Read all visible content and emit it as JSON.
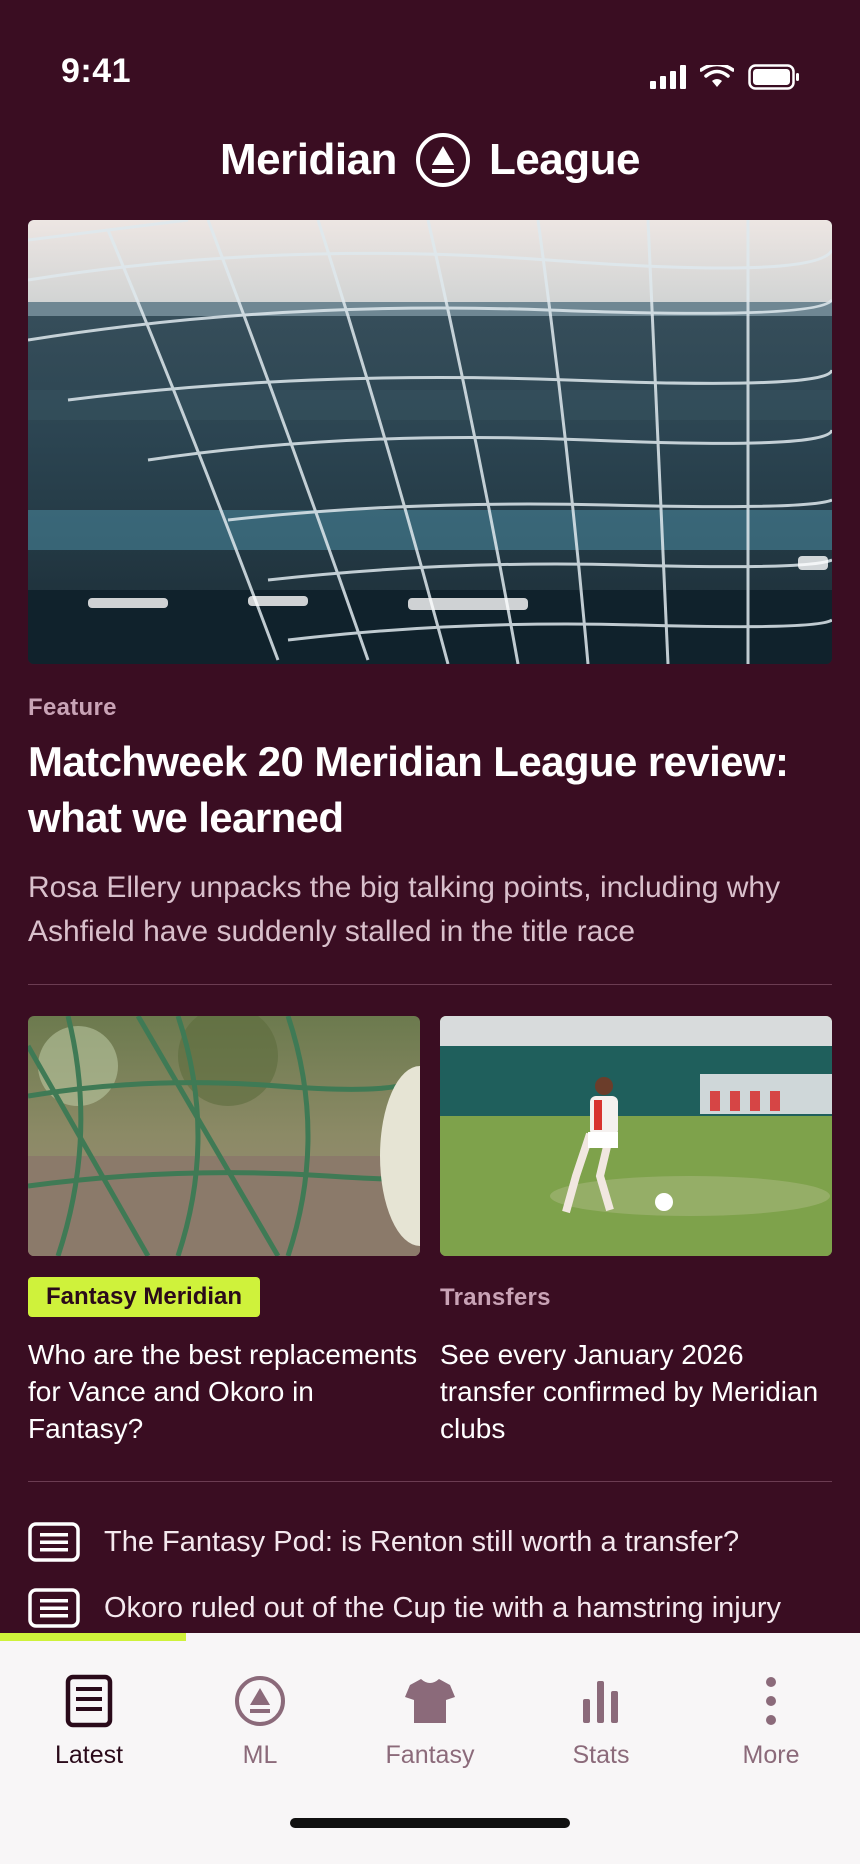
{
  "status": {
    "time": "9:41"
  },
  "header": {
    "brand_left": "Meridian",
    "brand_right": "League"
  },
  "hero": {
    "kicker": "Feature",
    "title": "Matchweek 20 Meridian League review: what we learned",
    "summary": "Rosa Ellery unpacks the big talking points, including why Ashfield have suddenly stalled in the title race"
  },
  "cards": [
    {
      "badge": "Fantasy Meridian",
      "title": "Who are the best replacements for Vance and Okoro in Fantasy?"
    },
    {
      "kicker": "Transfers",
      "title": "See every January 2026 transfer confirmed by Meridian clubs"
    }
  ],
  "list": [
    {
      "icon": "article-icon",
      "text": "The Fantasy Pod: is Renton still worth a transfer?"
    },
    {
      "icon": "article-icon",
      "text": "Okoro ruled out of the Cup tie with a hamstring injury"
    }
  ],
  "tabs": [
    {
      "label": "Latest",
      "icon": "article-icon",
      "active": true
    },
    {
      "label": "ML",
      "icon": "league-logo-icon",
      "active": false
    },
    {
      "label": "Fantasy",
      "icon": "shirt-icon",
      "active": false
    },
    {
      "label": "Stats",
      "icon": "bar-chart-icon",
      "active": false
    },
    {
      "label": "More",
      "icon": "more-vertical-icon",
      "active": false
    }
  ],
  "colors": {
    "background": "#3a0d22",
    "accent": "#cff23b",
    "kicker": "#c9a3b6",
    "tab_bar": "#f8f6f7"
  }
}
